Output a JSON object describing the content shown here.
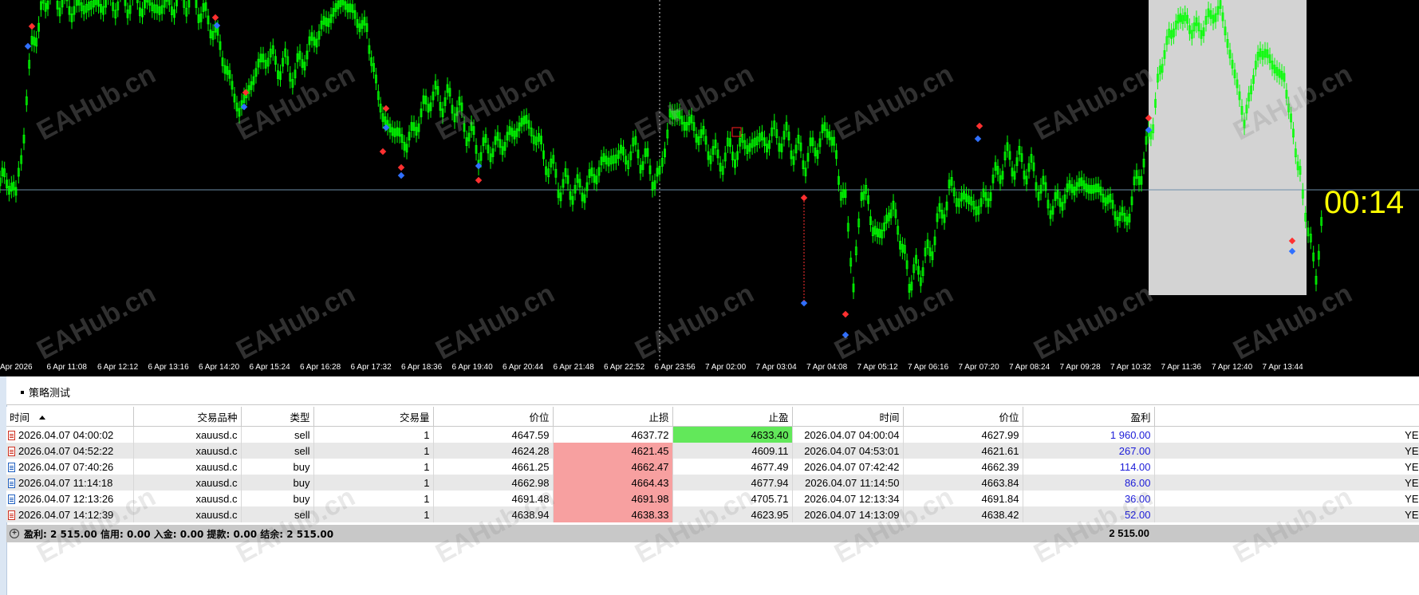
{
  "chart": {
    "background": "#000000",
    "candle_color": "#00ff00",
    "price_line_color": "#6e8ea8",
    "highlight_color": "#d3d3d3",
    "countdown": "00:14",
    "countdown_color": "#ffff00",
    "time_axis_labels": [
      "Apr 2026",
      "6 Apr 11:08",
      "6 Apr 12:12",
      "6 Apr 13:16",
      "6 Apr 14:20",
      "6 Apr 15:24",
      "6 Apr 16:28",
      "6 Apr 17:32",
      "6 Apr 18:36",
      "6 Apr 19:40",
      "6 Apr 20:44",
      "6 Apr 21:48",
      "6 Apr 22:52",
      "6 Apr 23:56",
      "7 Apr 02:00",
      "7 Apr 03:04",
      "7 Apr 04:08",
      "7 Apr 05:12",
      "7 Apr 06:16",
      "7 Apr 07:20",
      "7 Apr 08:24",
      "7 Apr 09:28",
      "7 Apr 10:32",
      "7 Apr 11:36",
      "7 Apr 12:40",
      "7 Apr 13:44"
    ]
  },
  "watermark_text": "EAHub.cn",
  "tester": {
    "tab_label": "策略测试"
  },
  "table": {
    "headers": [
      "时间",
      "交易品种",
      "类型",
      "交易量",
      "价位",
      "止损",
      "止盈",
      "时间",
      "价位",
      "盈利",
      ""
    ],
    "rows": [
      {
        "dir": "sell",
        "open_time": "2026.04.07 04:00:02",
        "symbol": "xauusd.c",
        "type": "sell",
        "volume": "1",
        "price": "4647.59",
        "sl": "4637.72",
        "tp": "4633.40",
        "close_time": "2026.04.07 04:00:04",
        "close_price": "4627.99",
        "profit": "1 960.00",
        "comment": "YE",
        "sl_hit": false,
        "tp_hit": true
      },
      {
        "dir": "sell",
        "open_time": "2026.04.07 04:52:22",
        "symbol": "xauusd.c",
        "type": "sell",
        "volume": "1",
        "price": "4624.28",
        "sl": "4621.45",
        "tp": "4609.11",
        "close_time": "2026.04.07 04:53:01",
        "close_price": "4621.61",
        "profit": "267.00",
        "comment": "YE",
        "sl_hit": true,
        "tp_hit": false
      },
      {
        "dir": "buy",
        "open_time": "2026.04.07 07:40:26",
        "symbol": "xauusd.c",
        "type": "buy",
        "volume": "1",
        "price": "4661.25",
        "sl": "4662.47",
        "tp": "4677.49",
        "close_time": "2026.04.07 07:42:42",
        "close_price": "4662.39",
        "profit": "114.00",
        "comment": "YE",
        "sl_hit": true,
        "tp_hit": false
      },
      {
        "dir": "buy",
        "open_time": "2026.04.07 11:14:18",
        "symbol": "xauusd.c",
        "type": "buy",
        "volume": "1",
        "price": "4662.98",
        "sl": "4664.43",
        "tp": "4677.94",
        "close_time": "2026.04.07 11:14:50",
        "close_price": "4663.84",
        "profit": "86.00",
        "comment": "YE",
        "sl_hit": true,
        "tp_hit": false
      },
      {
        "dir": "buy",
        "open_time": "2026.04.07 12:13:26",
        "symbol": "xauusd.c",
        "type": "buy",
        "volume": "1",
        "price": "4691.48",
        "sl": "4691.98",
        "tp": "4705.71",
        "close_time": "2026.04.07 12:13:34",
        "close_price": "4691.84",
        "profit": "36.00",
        "comment": "YE",
        "sl_hit": true,
        "tp_hit": false
      },
      {
        "dir": "sell",
        "open_time": "2026.04.07 14:12:39",
        "symbol": "xauusd.c",
        "type": "sell",
        "volume": "1",
        "price": "4638.94",
        "sl": "4638.33",
        "tp": "4623.95",
        "close_time": "2026.04.07 14:13:09",
        "close_price": "4638.42",
        "profit": "52.00",
        "comment": "YE",
        "sl_hit": true,
        "tp_hit": false
      }
    ]
  },
  "summary": {
    "text": "盈利: 2 515.00  信用: 0.00  入金: 0.00  提款: 0.00  结余: 2 515.00",
    "total": "2 515.00"
  }
}
